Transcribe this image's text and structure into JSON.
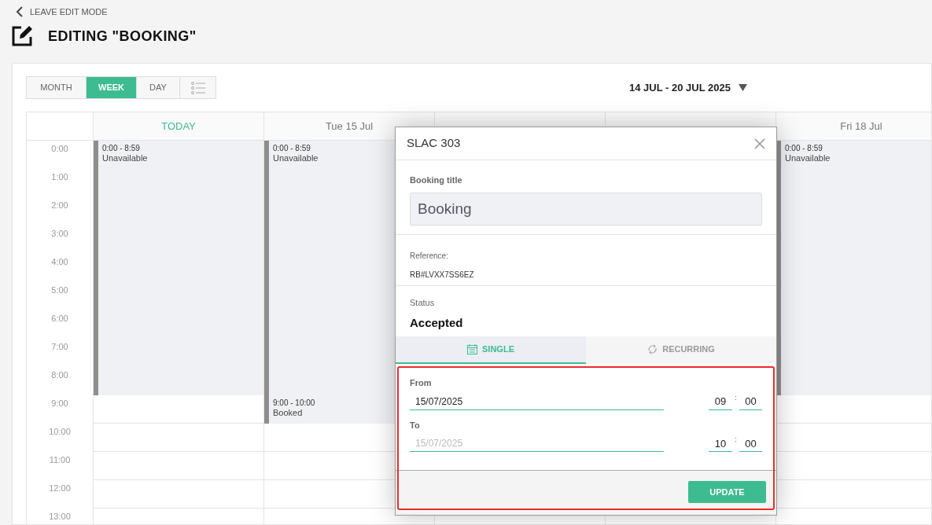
{
  "back_link": "LEAVE EDIT MODE",
  "title": "EDITING \"BOOKING\"",
  "view_tabs": [
    {
      "label": "MONTH",
      "selected": false
    },
    {
      "label": "WEEK",
      "selected": true
    },
    {
      "label": "DAY",
      "selected": false
    },
    {
      "kind": "list",
      "selected": false
    }
  ],
  "date_range": "14 JUL - 20 JUL 2025",
  "calendar": {
    "hours": [
      "0:00",
      "1:00",
      "2:00",
      "3:00",
      "4:00",
      "5:00",
      "6:00",
      "7:00",
      "8:00",
      "9:00",
      "10:00",
      "11:00",
      "12:00",
      "13:00"
    ],
    "days": [
      {
        "label": "TODAY",
        "today": true,
        "events": [
          {
            "time": "0:00 - 8:59",
            "label": "Unavailable"
          }
        ]
      },
      {
        "label": "Tue 15 Jul",
        "today": false,
        "events": [
          {
            "time": "0:00 - 8:59",
            "label": "Unavailable"
          },
          {
            "time": "9:00 - 10:00",
            "label": "Booked"
          }
        ]
      },
      {
        "label": "Fri 18 Jul",
        "today": false,
        "events": [
          {
            "time": "0:00 - 8:59",
            "label": "Unavailable"
          }
        ]
      }
    ]
  },
  "dialog": {
    "title": "SLAC 303",
    "booking_title": {
      "label": "Booking title",
      "value": "Booking"
    },
    "reference": {
      "label": "Reference:",
      "value": "RB#LVXX7SS6EZ"
    },
    "status": {
      "label": "Status",
      "value": "Accepted"
    },
    "tabs": [
      {
        "label": "SINGLE",
        "selected": true
      },
      {
        "label": "RECURRING",
        "selected": false
      }
    ],
    "ranges": [
      {
        "label": "From",
        "date": "15/07/2025",
        "date_disabled": false,
        "hour": "09",
        "separator": ":",
        "minute": "00"
      },
      {
        "label": "To",
        "date": "15/07/2025",
        "date_disabled": true,
        "hour": "10",
        "separator": ":",
        "minute": "00"
      }
    ],
    "button": "UPDATE"
  }
}
